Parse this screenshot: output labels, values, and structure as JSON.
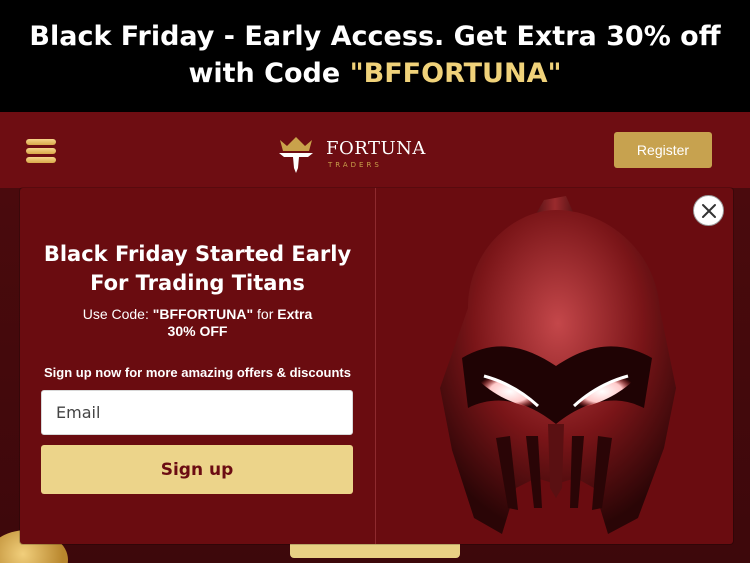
{
  "promo": {
    "text_before": "Black Friday - Early Access. Get Extra 30% off with Code ",
    "code": "\"BFFORTUNA\""
  },
  "header": {
    "logo_name": "FORTUNA",
    "logo_sub": "TRADERS",
    "register_label": "Register",
    "menu_icon": "hamburger-icon"
  },
  "modal": {
    "title_line1": "Black Friday Started Early",
    "title_line2": "For Trading Titans",
    "code_prefix": "Use Code: ",
    "code_value": "\"BFFORTUNA\"",
    "code_mid": " for ",
    "code_offer": "Extra 30% OFF",
    "signup_note": "Sign up now for more amazing offers & discounts",
    "email_placeholder": "Email",
    "signup_label": "Sign up",
    "close_icon": "close-icon",
    "image": "spartan-helmet-image"
  },
  "colors": {
    "brand_red": "#6e0d12",
    "gold": "#c7a24f",
    "button_gold": "#ecd48a",
    "code_gold": "#f0d27a"
  }
}
